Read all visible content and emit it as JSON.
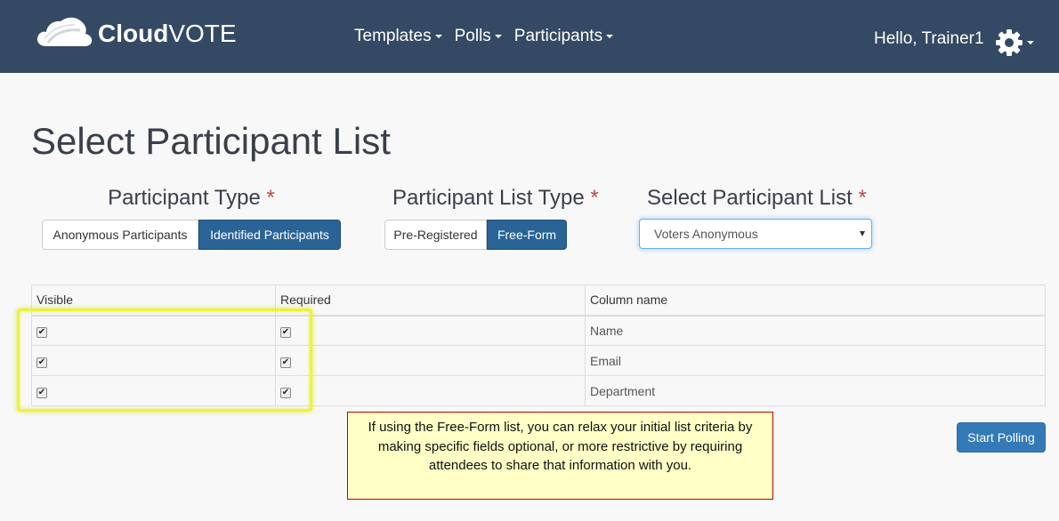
{
  "brand": {
    "name_bold": "Cloud",
    "name_light": "VOTE"
  },
  "nav": {
    "items": [
      {
        "label": "Templates"
      },
      {
        "label": "Polls"
      },
      {
        "label": "Participants"
      }
    ],
    "greeting": "Hello, Trainer1",
    "settings_icon": "gear-icon"
  },
  "page": {
    "title": "Select Participant List"
  },
  "participant_type": {
    "label": "Participant Type",
    "required_mark": "*",
    "options": [
      "Anonymous Participants",
      "Identified Participants"
    ],
    "selected": "Identified Participants"
  },
  "list_type": {
    "label": "Participant List Type",
    "required_mark": "*",
    "options": [
      "Pre-Registered",
      "Free-Form"
    ],
    "selected": "Free-Form"
  },
  "select_list": {
    "label": "Select Participant List",
    "required_mark": "*",
    "value": "Voters Anonymous"
  },
  "table": {
    "headers": [
      "Visible",
      "Required",
      "Column name"
    ],
    "rows": [
      {
        "visible": true,
        "required": true,
        "column_name": "Name"
      },
      {
        "visible": true,
        "required": true,
        "column_name": "Email"
      },
      {
        "visible": true,
        "required": true,
        "column_name": "Department"
      }
    ]
  },
  "callout": {
    "text": "If using the Free-Form list, you can relax your initial list criteria by making specific fields optional, or more restrictive by requiring attendees to share that information with you."
  },
  "actions": {
    "start_polling": "Start Polling"
  },
  "colors": {
    "navbar": "#344963",
    "active_button": "#2a6496",
    "primary_button": "#337ab7",
    "required": "#b94a48",
    "highlight": "#eef23a",
    "callout_bg": "#ffffc6",
    "callout_border": "#c00000"
  }
}
